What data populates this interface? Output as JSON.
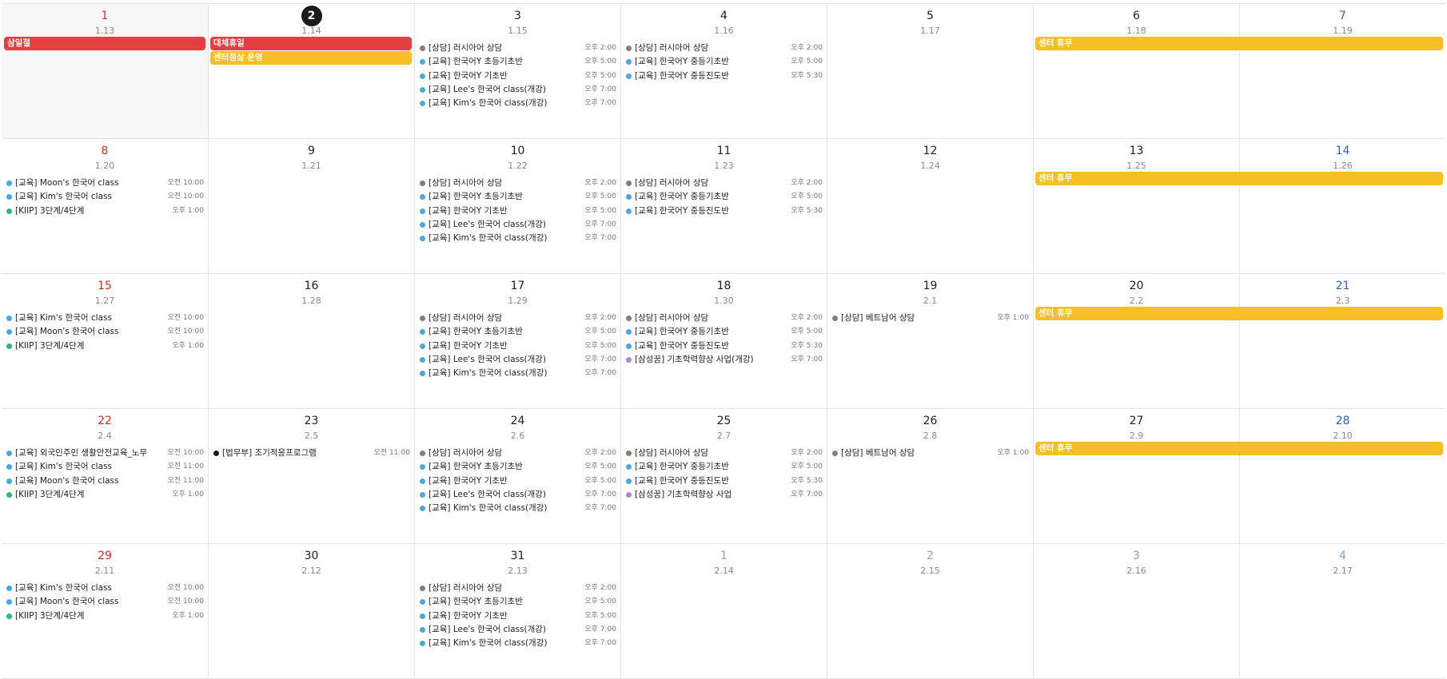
{
  "colors": {
    "holiday_red": "#e53e3e",
    "closure_yellow": "#f6bf26",
    "category_counsel": "#8d7b73",
    "category_edu": "#4aa8e0",
    "category_kiip": "#33b679",
    "category_law": "#1b1b1b",
    "category_samsung": "#b085d6",
    "sunday_text": "#d62c2c",
    "saturday_text": "#2b63c7",
    "today_circle": "#1b1b1b"
  },
  "weeks": [
    {
      "days": [
        {
          "day": "1",
          "lunar": "1.13",
          "kind": "sun",
          "shaded": true,
          "events": []
        },
        {
          "day": "2",
          "lunar": "1.14",
          "kind": "today",
          "events": []
        },
        {
          "day": "3",
          "lunar": "1.15",
          "events": [
            {
              "cat": "counsel",
              "title": "[상담] 러시아어 상담",
              "time": "오후 2:00"
            },
            {
              "cat": "edu",
              "title": "[교육] 한국어Y 초등기초반",
              "time": "오후 5:00"
            },
            {
              "cat": "edu",
              "title": "[교육] 한국어Y 기초반",
              "time": "오후 5:00"
            },
            {
              "cat": "edu",
              "title": "[교육] Lee's 한국어 class(개강)",
              "time": "오후 7:00"
            },
            {
              "cat": "edu",
              "title": "[교육] Kim's 한국어 class(개강)",
              "time": "오후 7:00"
            }
          ]
        },
        {
          "day": "4",
          "lunar": "1.16",
          "events": [
            {
              "cat": "counsel",
              "title": "[상담] 러시아어 상담",
              "time": "오후 2:00"
            },
            {
              "cat": "edu",
              "title": "[교육] 한국어Y 중등기초반",
              "time": "오후 5:00"
            },
            {
              "cat": "edu",
              "title": "[교육] 한국어Y 중등진도반",
              "time": "오후 5:30"
            }
          ]
        },
        {
          "day": "5",
          "lunar": "1.17",
          "events": []
        },
        {
          "day": "6",
          "lunar": "1.18",
          "events": []
        },
        {
          "day": "7",
          "lunar": "1.19",
          "kind": "sat",
          "events": []
        }
      ],
      "bars": [
        {
          "start": 0,
          "span": 1,
          "lane": 0,
          "color": "red",
          "title": "삼일절"
        },
        {
          "start": 1,
          "span": 1,
          "lane": 0,
          "color": "red",
          "title": "대체휴일"
        },
        {
          "start": 1,
          "span": 1,
          "lane": 1,
          "color": "yellow",
          "title": "센터정상 운영"
        },
        {
          "start": 5,
          "span": 2,
          "lane": 0,
          "color": "yellow",
          "title": "센터 휴무"
        }
      ]
    },
    {
      "days": [
        {
          "day": "8",
          "lunar": "1.20",
          "kind": "sun",
          "events": [
            {
              "cat": "edu",
              "title": "[교육] Moon's 한국어 class",
              "time": "오전 10:00"
            },
            {
              "cat": "edu",
              "title": "[교육] Kim's 한국어 class",
              "time": "오전 10:00"
            },
            {
              "cat": "kiip",
              "title": "[KIIP] 3단계/4단계",
              "time": "오후 1:00"
            }
          ]
        },
        {
          "day": "9",
          "lunar": "1.21",
          "events": []
        },
        {
          "day": "10",
          "lunar": "1.22",
          "events": [
            {
              "cat": "counsel",
              "title": "[상담] 러시아어 상담",
              "time": "오후 2:00"
            },
            {
              "cat": "edu",
              "title": "[교육] 한국어Y 초등기초반",
              "time": "오후 5:00"
            },
            {
              "cat": "edu",
              "title": "[교육] 한국어Y 기초반",
              "time": "오후 5:00"
            },
            {
              "cat": "edu",
              "title": "[교육] Lee's 한국어 class(개강)",
              "time": "오후 7:00"
            },
            {
              "cat": "edu",
              "title": "[교육] Kim's 한국어 class(개강)",
              "time": "오후 7:00"
            }
          ]
        },
        {
          "day": "11",
          "lunar": "1.23",
          "events": [
            {
              "cat": "counsel",
              "title": "[상담] 러시아어 상담",
              "time": "오후 2:00"
            },
            {
              "cat": "edu",
              "title": "[교육] 한국어Y 중등기초반",
              "time": "오후 5:00"
            },
            {
              "cat": "edu",
              "title": "[교육] 한국어Y 중등진도반",
              "time": "오후 5:30"
            }
          ]
        },
        {
          "day": "12",
          "lunar": "1.24",
          "events": []
        },
        {
          "day": "13",
          "lunar": "1.25",
          "events": []
        },
        {
          "day": "14",
          "lunar": "1.26",
          "kind": "sat",
          "events": []
        }
      ],
      "bars": [
        {
          "start": 5,
          "span": 2,
          "lane": 0,
          "color": "yellow",
          "title": "센터 휴무"
        }
      ]
    },
    {
      "days": [
        {
          "day": "15",
          "lunar": "1.27",
          "kind": "sun",
          "events": [
            {
              "cat": "edu",
              "title": "[교육] Kim's 한국어 class",
              "time": "오전 10:00"
            },
            {
              "cat": "edu",
              "title": "[교육] Moon's 한국어 class",
              "time": "오전 10:00"
            },
            {
              "cat": "kiip",
              "title": "[KIIP] 3단계/4단계",
              "time": "오후 1:00"
            }
          ]
        },
        {
          "day": "16",
          "lunar": "1.28",
          "events": []
        },
        {
          "day": "17",
          "lunar": "1.29",
          "events": [
            {
              "cat": "counsel",
              "title": "[상담] 러시아어 상담",
              "time": "오후 2:00"
            },
            {
              "cat": "edu",
              "title": "[교육] 한국어Y 초등기초반",
              "time": "오후 5:00"
            },
            {
              "cat": "edu",
              "title": "[교육] 한국어Y 기초반",
              "time": "오후 5:00"
            },
            {
              "cat": "edu",
              "title": "[교육] Lee's 한국어 class(개강)",
              "time": "오후 7:00"
            },
            {
              "cat": "edu",
              "title": "[교육] Kim's 한국어 class(개강)",
              "time": "오후 7:00"
            }
          ]
        },
        {
          "day": "18",
          "lunar": "1.30",
          "events": [
            {
              "cat": "counsel",
              "title": "[상담] 러시아어 상담",
              "time": "오후 2:00"
            },
            {
              "cat": "edu",
              "title": "[교육] 한국어Y 중등기초반",
              "time": "오후 5:00"
            },
            {
              "cat": "edu",
              "title": "[교육] 한국어Y 중등진도반",
              "time": "오후 5:30"
            },
            {
              "cat": "samsung",
              "title": "[삼성꿈] 기초학력향상 사업(개강)",
              "time": "오후 7:00"
            }
          ]
        },
        {
          "day": "19",
          "lunar": "2.1",
          "events": [
            {
              "cat": "counsel",
              "title": "[상담] 베트남어 상담",
              "time": "오후 1:00"
            }
          ]
        },
        {
          "day": "20",
          "lunar": "2.2",
          "events": []
        },
        {
          "day": "21",
          "lunar": "2.3",
          "kind": "sat",
          "events": []
        }
      ],
      "bars": [
        {
          "start": 5,
          "span": 2,
          "lane": 0,
          "color": "yellow",
          "title": "센터 휴무"
        }
      ]
    },
    {
      "days": [
        {
          "day": "22",
          "lunar": "2.4",
          "kind": "sun",
          "events": [
            {
              "cat": "edu",
              "title": "[교육] 외국인주민 생활안전교육_노무",
              "time": "오전 10:00"
            },
            {
              "cat": "edu",
              "title": "[교육] Kim's 한국어 class",
              "time": "오전 11:00"
            },
            {
              "cat": "edu",
              "title": "[교육] Moon's 한국어 class",
              "time": "오전 11:00"
            },
            {
              "cat": "kiip",
              "title": "[KIIP] 3단계/4단계",
              "time": "오후 1:00"
            }
          ]
        },
        {
          "day": "23",
          "lunar": "2.5",
          "events": [
            {
              "cat": "law",
              "title": "[법무부] 조기적응프로그램",
              "time": "오전 11:00"
            }
          ]
        },
        {
          "day": "24",
          "lunar": "2.6",
          "events": [
            {
              "cat": "counsel",
              "title": "[상담] 러시아어 상담",
              "time": "오후 2:00"
            },
            {
              "cat": "edu",
              "title": "[교육] 한국어Y 초등기초반",
              "time": "오후 5:00"
            },
            {
              "cat": "edu",
              "title": "[교육] 한국어Y 기초반",
              "time": "오후 5:00"
            },
            {
              "cat": "edu",
              "title": "[교육] Lee's 한국어 class(개강)",
              "time": "오후 7:00"
            },
            {
              "cat": "edu",
              "title": "[교육] Kim's 한국어 class(개강)",
              "time": "오후 7:00"
            }
          ]
        },
        {
          "day": "25",
          "lunar": "2.7",
          "events": [
            {
              "cat": "counsel",
              "title": "[상담] 러시아어 상담",
              "time": "오후 2:00"
            },
            {
              "cat": "edu",
              "title": "[교육] 한국어Y 중등기초반",
              "time": "오후 5:00"
            },
            {
              "cat": "edu",
              "title": "[교육] 한국어Y 중등진도반",
              "time": "오후 5:30"
            },
            {
              "cat": "samsung",
              "title": "[삼성꿈] 기초학력향상 사업",
              "time": "오후 7:00"
            }
          ]
        },
        {
          "day": "26",
          "lunar": "2.8",
          "events": [
            {
              "cat": "counsel",
              "title": "[상담] 베트남어 상담",
              "time": "오후 1:00"
            }
          ]
        },
        {
          "day": "27",
          "lunar": "2.9",
          "events": []
        },
        {
          "day": "28",
          "lunar": "2.10",
          "kind": "sat",
          "events": []
        }
      ],
      "bars": [
        {
          "start": 5,
          "span": 2,
          "lane": 0,
          "color": "yellow",
          "title": "센터 휴무"
        }
      ]
    },
    {
      "days": [
        {
          "day": "29",
          "lunar": "2.11",
          "kind": "sun",
          "events": [
            {
              "cat": "edu",
              "title": "[교육] Kim's 한국어 class",
              "time": "오전 10:00"
            },
            {
              "cat": "edu",
              "title": "[교육] Moon's 한국어 class",
              "time": "오전 10:00"
            },
            {
              "cat": "kiip",
              "title": "[KIIP] 3단계/4단계",
              "time": "오후 1:00"
            }
          ]
        },
        {
          "day": "30",
          "lunar": "2.12",
          "events": []
        },
        {
          "day": "31",
          "lunar": "2.13",
          "events": [
            {
              "cat": "counsel",
              "title": "[상담] 러시아어 상담",
              "time": "오후 2:00"
            },
            {
              "cat": "edu",
              "title": "[교육] 한국어Y 초등기초반",
              "time": "오후 5:00"
            },
            {
              "cat": "edu",
              "title": "[교육] 한국어Y 기초반",
              "time": "오후 5:00"
            },
            {
              "cat": "edu",
              "title": "[교육] Lee's 한국어 class(개강)",
              "time": "오후 7:00"
            },
            {
              "cat": "edu",
              "title": "[교육] Kim's 한국어 class(개강)",
              "time": "오후 7:00"
            }
          ]
        },
        {
          "day": "1",
          "lunar": "2.14",
          "kind": "other",
          "events": []
        },
        {
          "day": "2",
          "lunar": "2.15",
          "kind": "other",
          "events": []
        },
        {
          "day": "3",
          "lunar": "2.16",
          "kind": "other",
          "events": []
        },
        {
          "day": "4",
          "lunar": "2.17",
          "kind": "other-sat",
          "events": []
        }
      ],
      "bars": []
    }
  ]
}
